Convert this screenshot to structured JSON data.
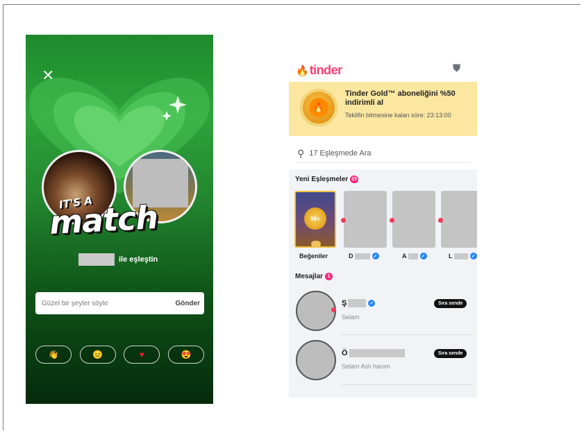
{
  "match_screen": {
    "headline_small": "IT'S A",
    "headline_big": "match",
    "matched_suffix": "ile eşleştin",
    "message_placeholder": "Güzel bir şeyler söyle",
    "send_label": "Gönder",
    "quick_replies": [
      "👋",
      "😐",
      "♥",
      "😍"
    ]
  },
  "app": {
    "logo": "tinder",
    "brand_color": "#fe3c72",
    "promo": {
      "title": "Tinder Gold™ aboneliğini %50 indirimli al",
      "countdown": "Teklifin bitmesine kalan süre: 23:13:00"
    },
    "search_placeholder": "17 Eşleşmede Ara",
    "new_matches": {
      "title": "Yeni Eşleşmeler",
      "count": "15",
      "likes_count": "99+",
      "likes_label": "Beğeniler",
      "cards": [
        {
          "initial": "D"
        },
        {
          "initial": "A"
        },
        {
          "initial": "L"
        }
      ]
    },
    "messages": {
      "title": "Mesajlar",
      "count": "1",
      "items": [
        {
          "initial": "Ş",
          "preview": "Selam",
          "badge": "Sıra sende"
        },
        {
          "initial": "Ö",
          "preview": "Selam Aslı hanım",
          "badge": "Sıra sende"
        }
      ]
    }
  }
}
